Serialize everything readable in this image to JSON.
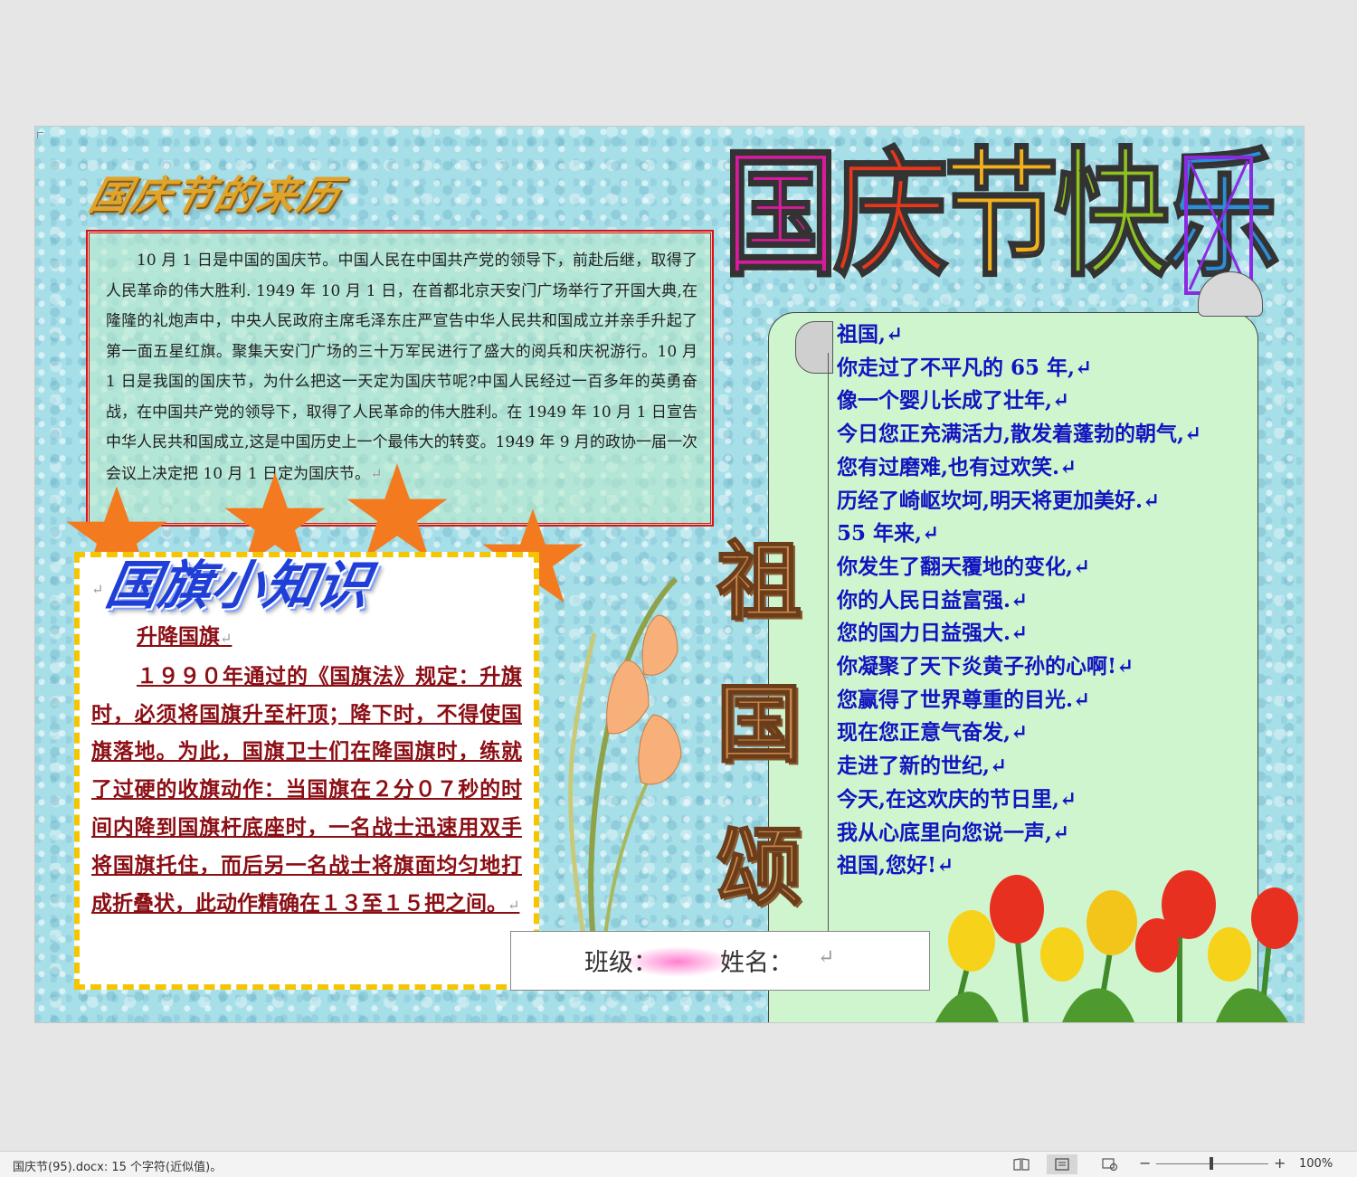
{
  "document": {
    "origin_section": {
      "title": "国庆节的来历",
      "text": "10 月 1 日是中国的国庆节。中国人民在中国共产党的领导下，前赴后继，取得了人民革命的伟大胜利. 1949 年 10 月 1 日，在首都北京天安门广场举行了开国大典,在隆隆的礼炮声中，中央人民政府主席毛泽东庄严宣告中华人民共和国成立并亲手升起了第一面五星红旗。聚集天安门广场的三十万军民进行了盛大的阅兵和庆祝游行。10 月 1 日是我国的国庆节，为什么把这一天定为国庆节呢?中国人民经过一百多年的英勇奋战，在中国共产党的领导下，取得了人民革命的伟大胜利。在 1949 年 10 月 1 日宣告中华人民共和国成立,这是中国历史上一个最伟大的转变。1949 年 9 月的政协一届一次会议上决定把 10 月 1 日定为国庆节。",
      "end_mark": "↵"
    },
    "flag_section": {
      "title": "国旗小知识",
      "empty_mark": "↵",
      "subtitle": "升降国旗",
      "body": "１９９０年通过的《国旗法》规定：升旗时，必须将国旗升至杆顶；降下时，不得使国旗落地。为此，国旗卫士们在降国旗时，练就了过硬的收旗动作：当国旗在２分０７秒的时间内降到国旗杆底座时，一名战士迅速用双手将国旗托住，而后另一名战士将旗面均匀地打成折叠状，此动作精确在１３至１５把之间。",
      "end_mark": "↵"
    },
    "main_title": {
      "chars": [
        "国",
        "庆",
        "节",
        "快",
        "乐"
      ]
    },
    "vertical_title": [
      "祖",
      "国",
      "颂"
    ],
    "poem": [
      "祖国,↵",
      "你走过了不平凡的 65 年,↵",
      "像一个婴儿长成了壮年,↵",
      "今日您正充满活力,散发着蓬勃的朝气,↵",
      "您有过磨难,也有过欢笑.↵",
      "历经了崎岖坎坷,明天将更加美好.↵",
      "55 年来,↵",
      "你发生了翻天覆地的变化,↵",
      "你的人民日益富强.↵",
      "您的国力日益强大.↵",
      "你凝聚了天下炎黄子孙的心啊!↵",
      "您赢得了世界尊重的目光.↵",
      "现在您正意气奋发,↵",
      "走进了新的世纪,↵",
      "今天,在这欢庆的节日里,↵",
      "我从心底里向您说一声,↵",
      "祖国,您好!↵"
    ],
    "footer": {
      "class_label": "班级：",
      "name_label": "姓名：",
      "end_mark": "↵"
    }
  },
  "status_bar": {
    "doc_info": "国庆节(95).docx: 15 个字符(近似值)。",
    "zoom_minus": "−",
    "zoom_plus": "+",
    "zoom_level": "100%",
    "zoom_fraction": 0.5
  },
  "colors": {
    "origin_border": "#e01010",
    "flag_text": "#8b0e14",
    "poem_text": "#1313c0",
    "flag_border": "#f5c600",
    "star": "#f47a1f"
  },
  "icons": {
    "read_mode": "book-icon",
    "print_layout": "page-icon",
    "web_layout": "web-icon"
  }
}
